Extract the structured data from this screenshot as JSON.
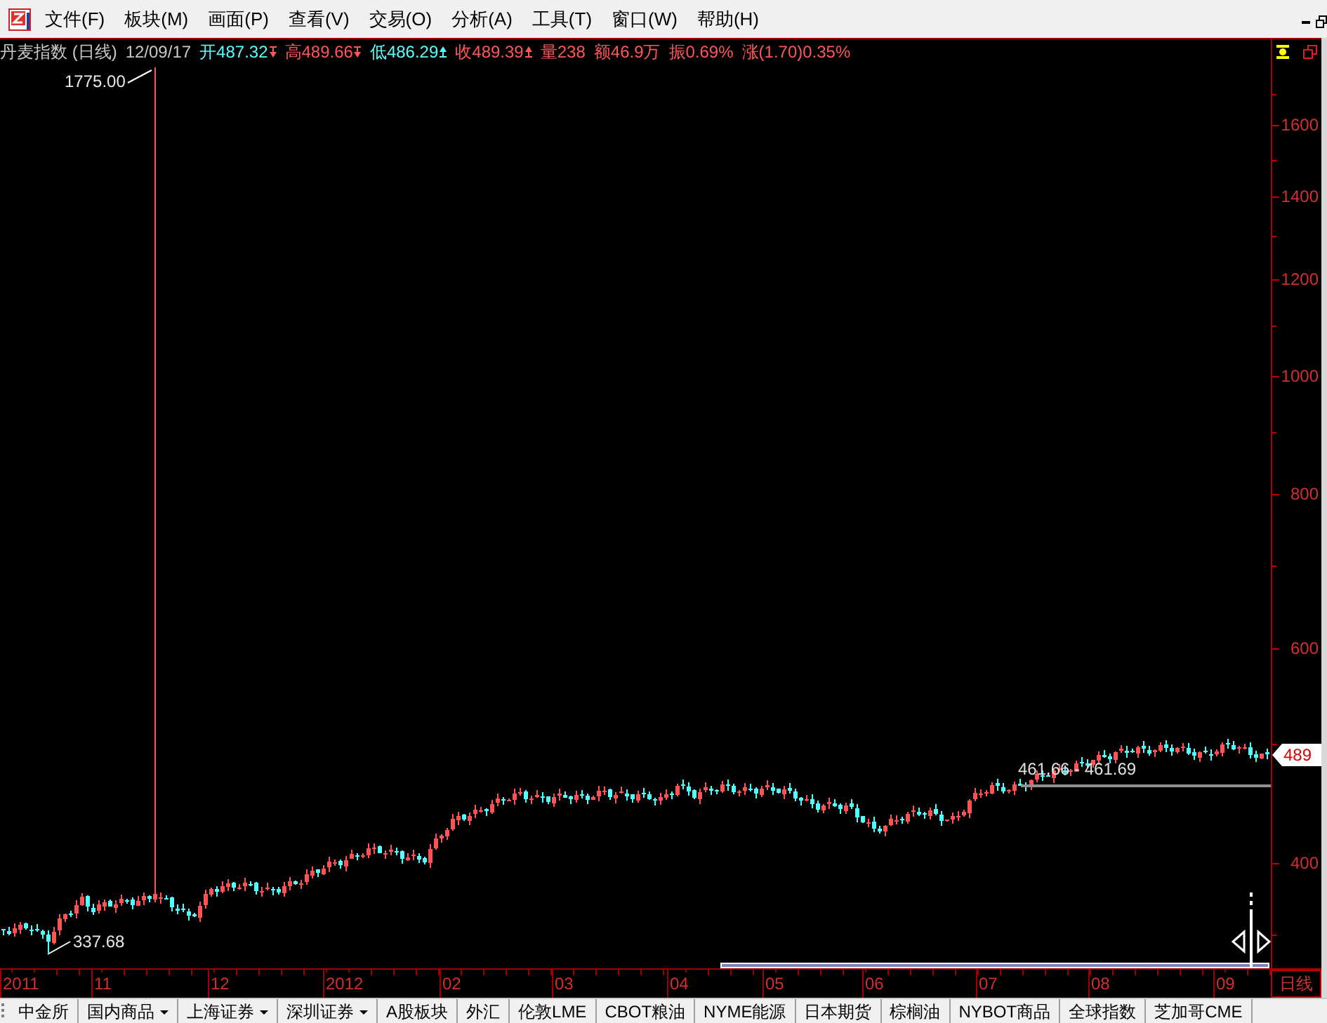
{
  "menu_bar": {
    "items": [
      "文件(F)",
      "板块(M)",
      "画面(P)",
      "查看(V)",
      "交易(O)",
      "分析(A)",
      "工具(T)",
      "窗口(W)",
      "帮助(H)"
    ]
  },
  "quote": {
    "name": "丹麦指数 (日线)",
    "date": "12/09/17",
    "fields": [
      {
        "text": "开487.32",
        "color": "#57ffff",
        "arrow": {
          "kind": "down",
          "color": "#ff5757"
        }
      },
      {
        "text": "高489.66",
        "color": "#ff5757",
        "arrow": {
          "kind": "down",
          "color": "#ff5757"
        }
      },
      {
        "text": "低486.29",
        "color": "#57ffff",
        "arrow": {
          "kind": "up",
          "color": "#57ffff"
        }
      },
      {
        "text": "收489.39",
        "color": "#ff5757",
        "arrow": {
          "kind": "up",
          "color": "#ff5757"
        }
      },
      {
        "text": "量238",
        "color": "#ff5757"
      },
      {
        "text": "额46.9万",
        "color": "#ff5757"
      },
      {
        "text": "振0.69%",
        "color": "#ff5757"
      },
      {
        "text": "涨(1.70)0.35%",
        "color": "#ff5757"
      }
    ]
  },
  "chart": {
    "high_label": "1775.00",
    "low_label": "337.68",
    "gap_label": "461.66 - 461.69"
  },
  "price_axis": {
    "labels": [
      "1600",
      "1400",
      "1200",
      "1000",
      "800",
      "600",
      "400"
    ],
    "current_price": "489"
  },
  "time_axis": {
    "labels": [
      "2011",
      "11",
      "12",
      "2012",
      "02",
      "03",
      "04",
      "05",
      "06",
      "07",
      "08",
      "09"
    ],
    "period": "日线"
  },
  "tab_bar": {
    "tabs": [
      {
        "label": "中金所",
        "dropdown": false
      },
      {
        "label": "国内商品",
        "dropdown": true
      },
      {
        "label": "上海证券",
        "dropdown": true
      },
      {
        "label": "深圳证券",
        "dropdown": true
      },
      {
        "label": "A股板块",
        "dropdown": false
      },
      {
        "label": "外汇",
        "dropdown": false
      },
      {
        "label": "伦敦LME",
        "dropdown": false
      },
      {
        "label": "CBOT粮油",
        "dropdown": false
      },
      {
        "label": "NYME能源",
        "dropdown": false
      },
      {
        "label": "日本期货",
        "dropdown": false
      },
      {
        "label": "棕榈油",
        "dropdown": false
      },
      {
        "label": "NYBOT商品",
        "dropdown": false
      },
      {
        "label": "全球指数",
        "dropdown": false
      },
      {
        "label": "芝加哥CME",
        "dropdown": false
      }
    ]
  }
}
